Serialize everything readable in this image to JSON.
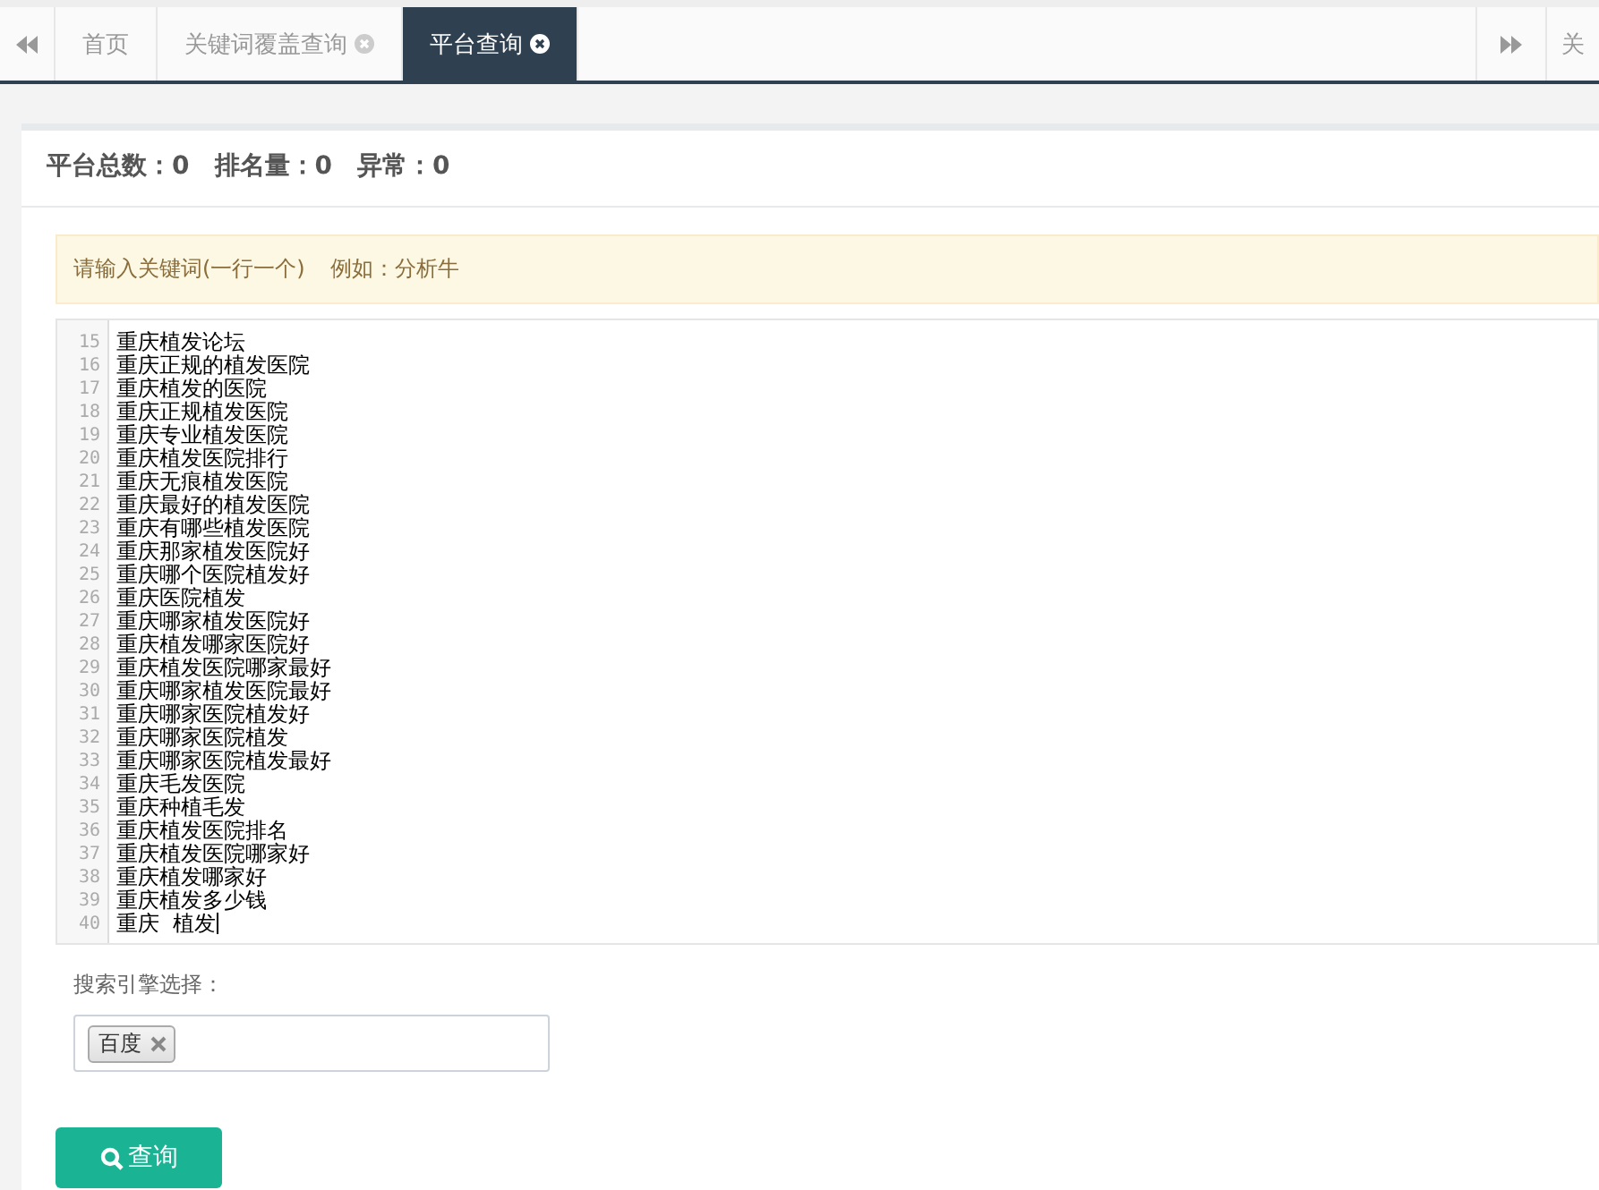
{
  "tabs": [
    {
      "label": "首页",
      "closable": false,
      "selected": false
    },
    {
      "label": "关键词覆盖查询",
      "closable": true,
      "selected": false
    },
    {
      "label": "平台查询",
      "closable": true,
      "selected": true
    }
  ],
  "tab_overflow": {
    "label": "关"
  },
  "stats": [
    {
      "label": "平台总数：",
      "value": "0"
    },
    {
      "label": "排名量：",
      "value": "0"
    },
    {
      "label": "异常：",
      "value": "0"
    }
  ],
  "alert": {
    "text": "请输入关键词(一行一个)",
    "example": "例如：分析牛"
  },
  "editor": {
    "lines": [
      {
        "number": "15",
        "text": "重庆植发论坛"
      },
      {
        "number": "16",
        "text": "重庆正规的植发医院"
      },
      {
        "number": "17",
        "text": "重庆植发的医院"
      },
      {
        "number": "18",
        "text": "重庆正规植发医院"
      },
      {
        "number": "19",
        "text": "重庆专业植发医院"
      },
      {
        "number": "20",
        "text": "重庆植发医院排行"
      },
      {
        "number": "21",
        "text": "重庆无痕植发医院"
      },
      {
        "number": "22",
        "text": "重庆最好的植发医院"
      },
      {
        "number": "23",
        "text": "重庆有哪些植发医院"
      },
      {
        "number": "24",
        "text": "重庆那家植发医院好"
      },
      {
        "number": "25",
        "text": "重庆哪个医院植发好"
      },
      {
        "number": "26",
        "text": "重庆医院植发"
      },
      {
        "number": "27",
        "text": "重庆哪家植发医院好"
      },
      {
        "number": "28",
        "text": "重庆植发哪家医院好"
      },
      {
        "number": "29",
        "text": "重庆植发医院哪家最好"
      },
      {
        "number": "30",
        "text": "重庆哪家植发医院最好"
      },
      {
        "number": "31",
        "text": "重庆哪家医院植发好"
      },
      {
        "number": "32",
        "text": "重庆哪家医院植发"
      },
      {
        "number": "33",
        "text": "重庆哪家医院植发最好"
      },
      {
        "number": "34",
        "text": "重庆毛发医院"
      },
      {
        "number": "35",
        "text": "重庆种植毛发"
      },
      {
        "number": "36",
        "text": "重庆植发医院排名"
      },
      {
        "number": "37",
        "text": "重庆植发医院哪家好"
      },
      {
        "number": "38",
        "text": "重庆植发哪家好"
      },
      {
        "number": "39",
        "text": "重庆植发多少钱"
      },
      {
        "number": "40",
        "text": "重庆  植发"
      }
    ]
  },
  "engine": {
    "label": "搜索引擎选择：",
    "tags": [
      "百度"
    ]
  },
  "query_button": {
    "label": "查询"
  }
}
